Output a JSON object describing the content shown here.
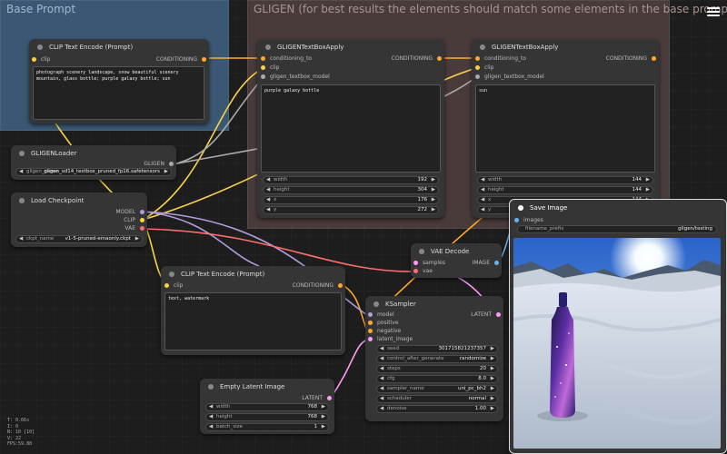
{
  "groups": {
    "base_prompt": "Base Prompt",
    "gligen": "GLIGEN (for best results the elements should match some elements in the base prompt)"
  },
  "clip_top": {
    "title": "CLIP Text Encode (Prompt)",
    "in_clip": "clip",
    "out_conditioning": "CONDITIONING",
    "text": "photograph scenery landscape, snow beautiful scenery mountain, glass bottle; purple galaxy bottle; sun"
  },
  "gligen_loader": {
    "title": "GLIGENLoader",
    "out": "GLIGEN",
    "widget_label": "gligen_name",
    "widget_value": "gligen_sd14_textbox_pruned_fp16.safetensors"
  },
  "load_checkpoint": {
    "title": "Load Checkpoint",
    "out_model": "MODEL",
    "out_clip": "CLIP",
    "out_vae": "VAE",
    "widget_label": "ckpt_name",
    "widget_value": "v1-5-pruned-emaonly.ckpt"
  },
  "gligen_box1": {
    "title": "GLIGENTextBoxApply",
    "in_conditioning": "conditioning_to",
    "in_clip": "clip",
    "in_model": "gligen_textbox_model",
    "out": "CONDITIONING",
    "text": "purple galaxy bottle",
    "width": "192",
    "height": "304",
    "x": "176",
    "y": "272"
  },
  "gligen_box2": {
    "title": "GLIGENTextBoxApply",
    "in_conditioning": "conditioning_to",
    "in_clip": "clip",
    "in_model": "gligen_textbox_model",
    "out": "CONDITIONING",
    "text": "sun",
    "width": "144",
    "height": "144",
    "x": "144",
    "y": "16"
  },
  "labels": {
    "width": "width",
    "height": "height",
    "x": "x",
    "y": "y"
  },
  "clip_bottom": {
    "title": "CLIP Text Encode (Prompt)",
    "in_clip": "clip",
    "out_conditioning": "CONDITIONING",
    "text": "text, watermark"
  },
  "vae_decode": {
    "title": "VAE Decode",
    "in_samples": "samples",
    "in_vae": "vae",
    "out": "IMAGE"
  },
  "ksampler": {
    "title": "KSampler",
    "in_model": "model",
    "in_positive": "positive",
    "in_negative": "negative",
    "in_latent": "latent_image",
    "out": "LATENT",
    "widgets": [
      {
        "label": "seed",
        "value": "301715821237357"
      },
      {
        "label": "control_after_generate",
        "value": "randomize"
      },
      {
        "label": "steps",
        "value": "20"
      },
      {
        "label": "cfg",
        "value": "8.0"
      },
      {
        "label": "sampler_name",
        "value": "uni_pc_bh2"
      },
      {
        "label": "scheduler",
        "value": "normal"
      },
      {
        "label": "denoise",
        "value": "1.00"
      }
    ]
  },
  "empty_latent": {
    "title": "Empty Latent Image",
    "out": "LATENT",
    "widgets": [
      {
        "label": "width",
        "value": "768"
      },
      {
        "label": "height",
        "value": "768"
      },
      {
        "label": "batch_size",
        "value": "1"
      }
    ]
  },
  "save_image": {
    "title": "Save Image",
    "in_images": "images",
    "widget_label": "filename_prefix",
    "widget_value": "gligen/testing"
  },
  "hud": {
    "line1": "T: 0.66s",
    "line2": "I: 0",
    "line3": "N: 10 [10]",
    "line4": "V: 22",
    "line5": "FPS:59.88"
  },
  "colors": {
    "clip_wire": "#f8d24a",
    "conditioning_wire": "#ffa931",
    "model_wire": "#b39ddb",
    "vae_wire": "#ff6e6e",
    "latent_wire": "#ff9cf9",
    "image_wire": "#64b5f6",
    "gligen_wire": "#aaaaaa"
  }
}
